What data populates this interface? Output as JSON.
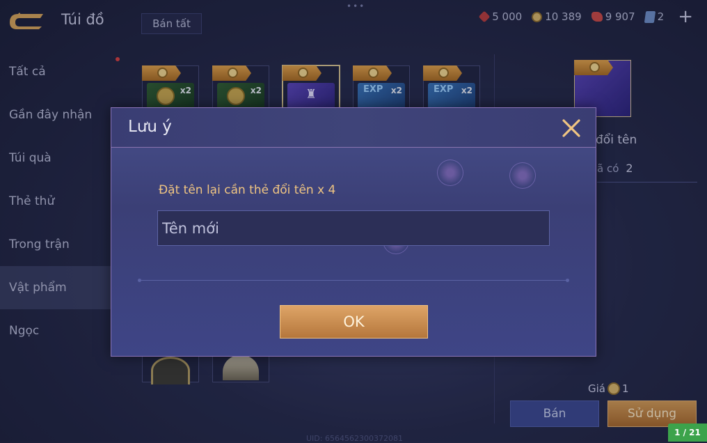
{
  "header": {
    "title": "Túi đồ",
    "sell_all_label": "Bán tất",
    "currencies": [
      {
        "icon": "red-gem-icon",
        "value": "5 000"
      },
      {
        "icon": "gold-coin-icon",
        "value": "10 389"
      },
      {
        "icon": "ruby-icon",
        "value": "9 907"
      },
      {
        "icon": "card-voucher-icon",
        "value": "2"
      }
    ],
    "add_label": "+"
  },
  "sidebar": {
    "items": [
      {
        "label": "Tất cả",
        "active": false
      },
      {
        "label": "Gần đây nhận",
        "active": false
      },
      {
        "label": "Túi quà",
        "active": false
      },
      {
        "label": "Thẻ thử",
        "active": false
      },
      {
        "label": "Trong trận",
        "active": false
      },
      {
        "label": "Vật phẩm",
        "active": true
      },
      {
        "label": "Ngọc",
        "active": false
      }
    ]
  },
  "grid": {
    "items": [
      {
        "type": "gold-card",
        "qty": "x2"
      },
      {
        "type": "gold-card",
        "qty": "x2"
      },
      {
        "type": "rename-card",
        "qty": ""
      },
      {
        "type": "exp-card",
        "exp": "EXP",
        "qty": "x2"
      },
      {
        "type": "exp-card",
        "exp": "EXP",
        "qty": "x2"
      }
    ]
  },
  "detail": {
    "name": "đổi tên",
    "owned_label": "ã có",
    "owned_value": "2",
    "price_label": "Giá",
    "price_value": "1",
    "sell_label": "Bán",
    "use_label": "Sử dụng"
  },
  "footer": {
    "uid": "UID: 6564562300372081",
    "page_counter": "1 / 21"
  },
  "modal": {
    "title": "Lưu ý",
    "prompt": "Đặt tên lại cần thẻ đổi tên x 4",
    "input_placeholder": "Tên mới",
    "input_value": "",
    "ok_label": "OK"
  },
  "colors": {
    "accent_gold": "#d29a55",
    "prompt_text": "#f0c582",
    "modal_border": "#8c74b8",
    "page_counter_bg": "#3ca34b"
  }
}
